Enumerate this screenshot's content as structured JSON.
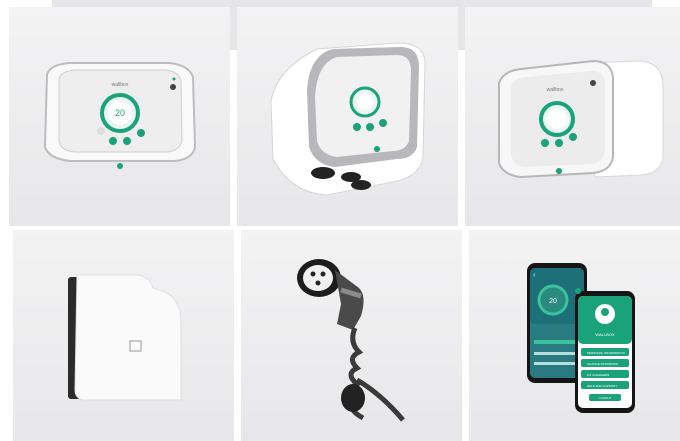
{
  "gallery": {
    "brand_text": "wallbox",
    "screen_value": "20",
    "screen_unit": "kWh",
    "phone_screen_value": "20",
    "phone_title": "WALLBOX",
    "phone_menu_items": [
      "PERSONAL INFORMATION",
      "CHANGE PASSWORD",
      "MY CHARGERS",
      "HELP AND SUPPORT"
    ],
    "phone_button": "LOGOUT",
    "icons": [
      "lock-icon",
      "power-icon",
      "info-icon",
      "user-icon",
      "settings-icon",
      "wifi-icon",
      "back-arrow-icon"
    ],
    "colors": {
      "accent": "#1aa37a",
      "accent_light": "#39c29b",
      "bezel": "#c9c9cc",
      "screen": "#f4f4f5"
    }
  }
}
